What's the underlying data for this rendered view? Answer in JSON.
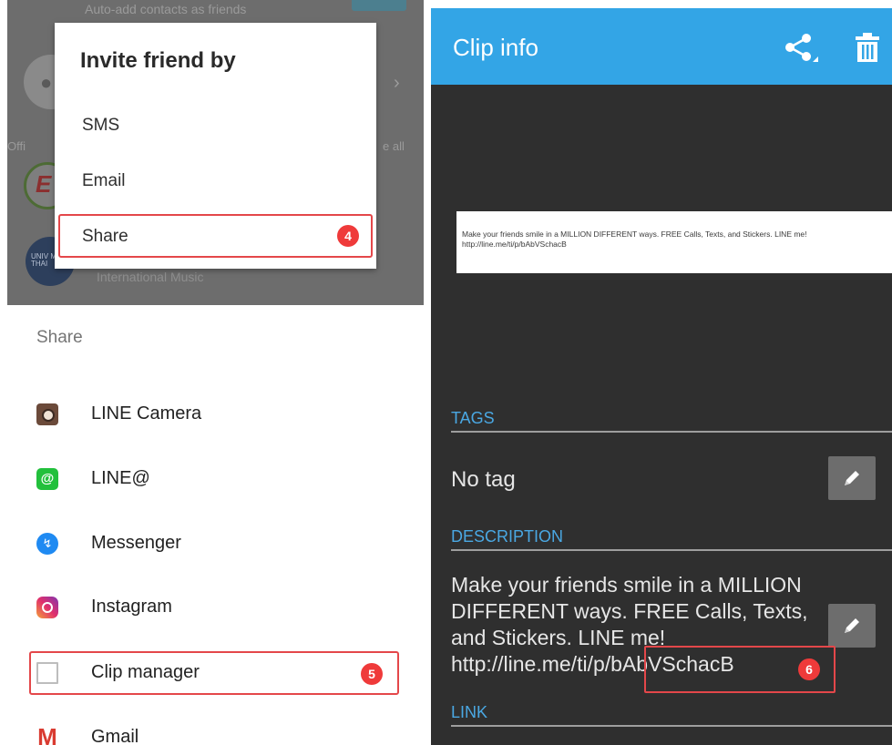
{
  "background_screen": {
    "top_text": "Auto-add contacts as friends",
    "chevron": "›",
    "official_label": "Offi",
    "see_all_label": "e all",
    "logo1_letter": "E",
    "logo2_text": "UNIV MUSI THAI",
    "intl_text": "International Music"
  },
  "invite_dialog": {
    "title": "Invite friend by",
    "options": [
      "SMS",
      "Email",
      "Share"
    ],
    "share_badge": "4"
  },
  "share_sheet": {
    "heading": "Share",
    "apps": [
      {
        "label": "LINE Camera",
        "icon": "line-camera-icon"
      },
      {
        "label": "LINE@",
        "icon": "line-at-icon",
        "glyph": "@"
      },
      {
        "label": "Messenger",
        "icon": "messenger-icon",
        "glyph": "↯"
      },
      {
        "label": "Instagram",
        "icon": "instagram-icon"
      },
      {
        "label": "Clip manager",
        "icon": "clip-manager-icon"
      },
      {
        "label": "Gmail",
        "icon": "gmail-icon",
        "glyph": "M"
      }
    ],
    "clip_badge": "5"
  },
  "clip_info": {
    "title": "Clip info",
    "accent": "#33a5e6",
    "preview_text": "Make your friends smile in a MILLION DIFFERENT ways. FREE Calls, Texts, and Stickers. LINE me!\nhttp://line.me/ti/p/bAbVSchacB",
    "tags_header": "TAGS",
    "tag_value": "No tag",
    "description_header": "DESCRIPTION",
    "description_text": "Make your friends smile in a MILLION DIFFERENT ways. FREE Calls, Texts, and Stickers. LINE me! http://line.me/ti/p/bAbVSchacB",
    "link_badge": "6",
    "link_header": "LINK"
  }
}
